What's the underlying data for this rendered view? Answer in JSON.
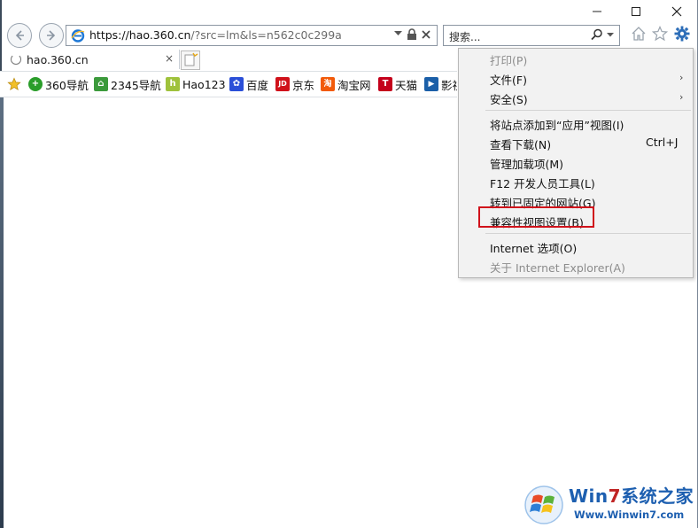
{
  "window": {
    "minimize_icon": "minimize-icon",
    "maximize_icon": "maximize-icon",
    "close_icon": "close-icon"
  },
  "nav": {
    "address_url_host": "https://hao.360.cn",
    "address_url_rest": "/?src=lm&ls=n562c0c299a",
    "search_placeholder": "搜索...",
    "icons": [
      "back-icon",
      "forward-icon",
      "ie-logo",
      "dropdown-icon",
      "lock-icon",
      "close-icon",
      "search-icon",
      "home-icon",
      "star-icon",
      "gear-icon"
    ]
  },
  "tabs": [
    {
      "title": "hao.360.cn",
      "close": "×"
    }
  ],
  "favorites": [
    {
      "label": "360导航",
      "icon_color": "#2a9d2a",
      "glyph": "+"
    },
    {
      "label": "2345导航",
      "icon_color": "#3c9a3c",
      "glyph": "⌂"
    },
    {
      "label": "Hao123",
      "icon_color": "#9fc23c",
      "glyph": "h"
    },
    {
      "label": "百度",
      "icon_color": "#2b4fd8",
      "glyph": "✿"
    },
    {
      "label": "京东",
      "icon_color": "#d0121b",
      "glyph": "JD"
    },
    {
      "label": "淘宝网",
      "icon_color": "#f25a0a",
      "glyph": "淘"
    },
    {
      "label": "天猫",
      "icon_color": "#c4001b",
      "glyph": "T"
    },
    {
      "label": "影视",
      "icon_color": "#1b5fa8",
      "glyph": "▶"
    }
  ],
  "menu": {
    "items": [
      {
        "label": "打印(P)",
        "disabled": true,
        "arrow": "",
        "shortcut": ""
      },
      {
        "label": "文件(F)",
        "disabled": false,
        "arrow": "›",
        "shortcut": ""
      },
      {
        "label": "安全(S)",
        "disabled": false,
        "arrow": "›",
        "shortcut": ""
      },
      {
        "label": "将站点添加到“应用”视图(I)",
        "disabled": false,
        "arrow": "",
        "shortcut": ""
      },
      {
        "label": "查看下载(N)",
        "disabled": false,
        "arrow": "",
        "shortcut": "Ctrl+J"
      },
      {
        "label": "管理加载项(M)",
        "disabled": false,
        "arrow": "",
        "shortcut": ""
      },
      {
        "label": "F12 开发人员工具(L)",
        "disabled": false,
        "arrow": "",
        "shortcut": ""
      },
      {
        "label": "转到已固定的网站(G)",
        "disabled": false,
        "arrow": "",
        "shortcut": ""
      },
      {
        "label": "兼容性视图设置(B)",
        "disabled": false,
        "arrow": "",
        "shortcut": ""
      },
      {
        "label": "Internet 选项(O)",
        "disabled": false,
        "arrow": "",
        "shortcut": ""
      },
      {
        "label": "关于 Internet Explorer(A)",
        "disabled": true,
        "arrow": "",
        "shortcut": ""
      }
    ]
  },
  "watermark": {
    "brand_prefix": "Win",
    "brand_seven": "7",
    "brand_suffix": "系统之家",
    "url": "Www.Winwin7.com"
  },
  "colors": {
    "highlight_box": "#d0121b",
    "menu_bg": "#f2f2f2",
    "accent_blue": "#1d5fb0"
  }
}
